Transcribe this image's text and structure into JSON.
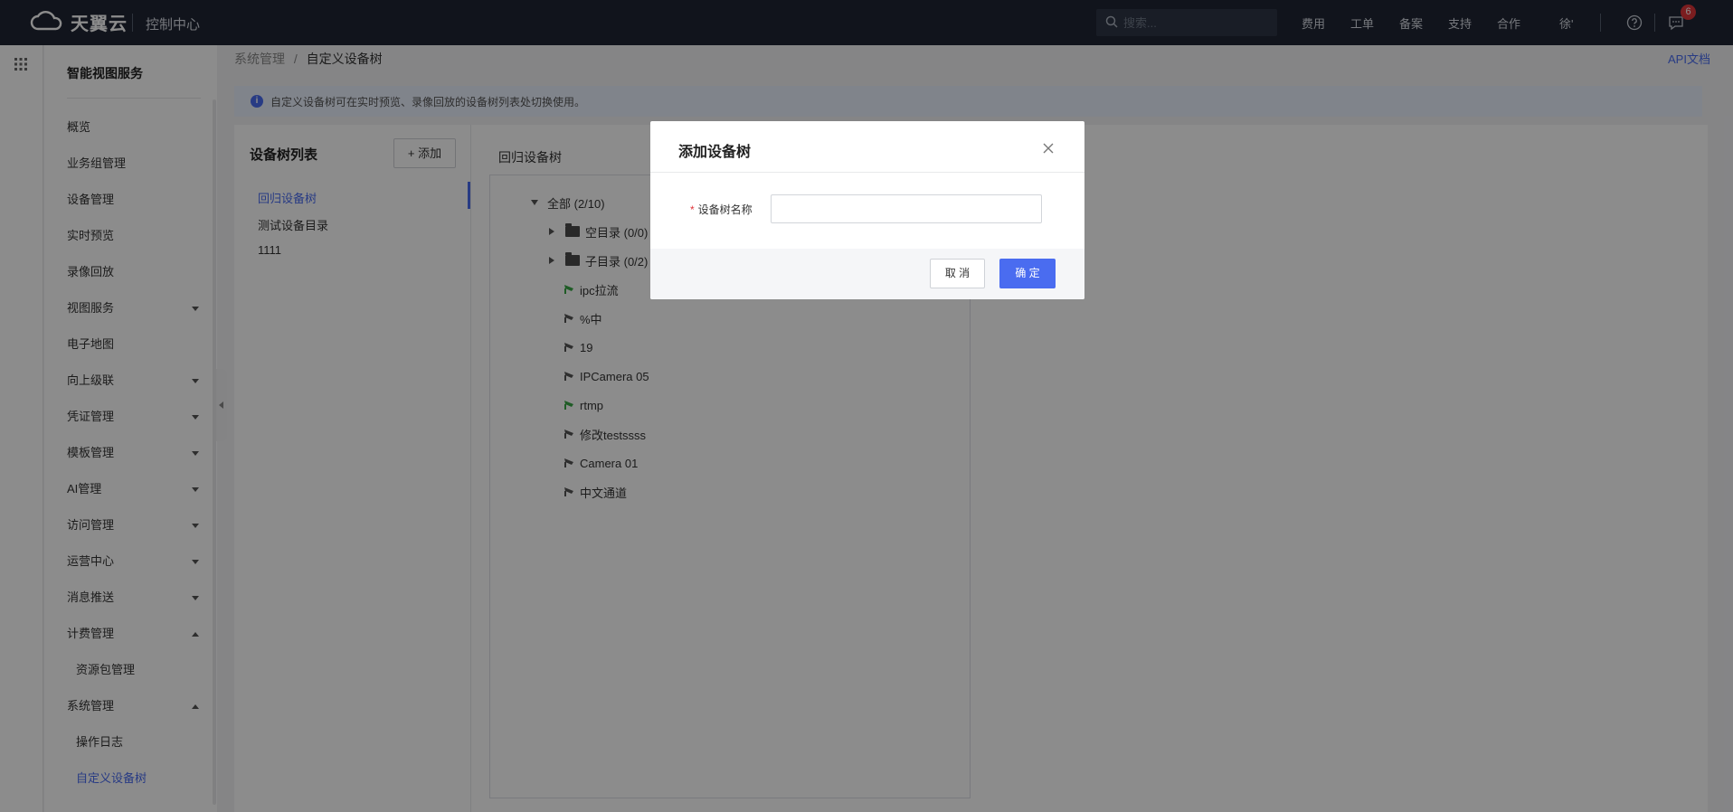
{
  "topbar": {
    "brand": "天翼云",
    "console_title": "控制中心",
    "search_placeholder": "搜索...",
    "nav": [
      "费用",
      "工单",
      "备案",
      "支持",
      "合作"
    ],
    "user": "徐'",
    "notification_count": "6"
  },
  "sidebar": {
    "title": "智能视图服务",
    "items": [
      {
        "label": "概览"
      },
      {
        "label": "业务组管理"
      },
      {
        "label": "设备管理"
      },
      {
        "label": "实时预览"
      },
      {
        "label": "录像回放"
      },
      {
        "label": "视图服务"
      },
      {
        "label": "电子地图"
      },
      {
        "label": "向上级联"
      },
      {
        "label": "凭证管理"
      },
      {
        "label": "模板管理"
      },
      {
        "label": "AI管理"
      },
      {
        "label": "访问管理"
      },
      {
        "label": "运营中心"
      },
      {
        "label": "消息推送"
      },
      {
        "label": "计费管理"
      },
      {
        "label": "资源包管理"
      },
      {
        "label": "系统管理"
      },
      {
        "label": "操作日志"
      },
      {
        "label": "自定义设备树"
      }
    ]
  },
  "breadcrumb": {
    "parent": "系统管理",
    "separator": "/",
    "current": "自定义设备树"
  },
  "api_doc": "API文档",
  "info": "自定义设备树可在实时预览、录像回放的设备树列表处切换使用。",
  "tree_list": {
    "title": "设备树列表",
    "add_label": "+ 添加",
    "items": [
      "回归设备树",
      "测试设备目录",
      "1111"
    ]
  },
  "tree_view": {
    "title": "回归设备树",
    "root": "全部 (2/10)",
    "folders": [
      "空目录 (0/0)",
      "子目录 (0/2)"
    ],
    "devices": [
      "ipc拉流",
      "%中",
      "19",
      "IPCamera 05",
      "rtmp",
      "修改testssss",
      "Camera 01",
      "中文通道"
    ]
  },
  "modal": {
    "title": "添加设备树",
    "field_label": "设备树名称",
    "field_value": "",
    "cancel_label": "取 消",
    "ok_label": "确 定"
  },
  "colors": {
    "accent": "#4a6cf0",
    "topbar": "#1f2533",
    "online_camera": "#3aa845",
    "offline_camera": "#555555"
  }
}
